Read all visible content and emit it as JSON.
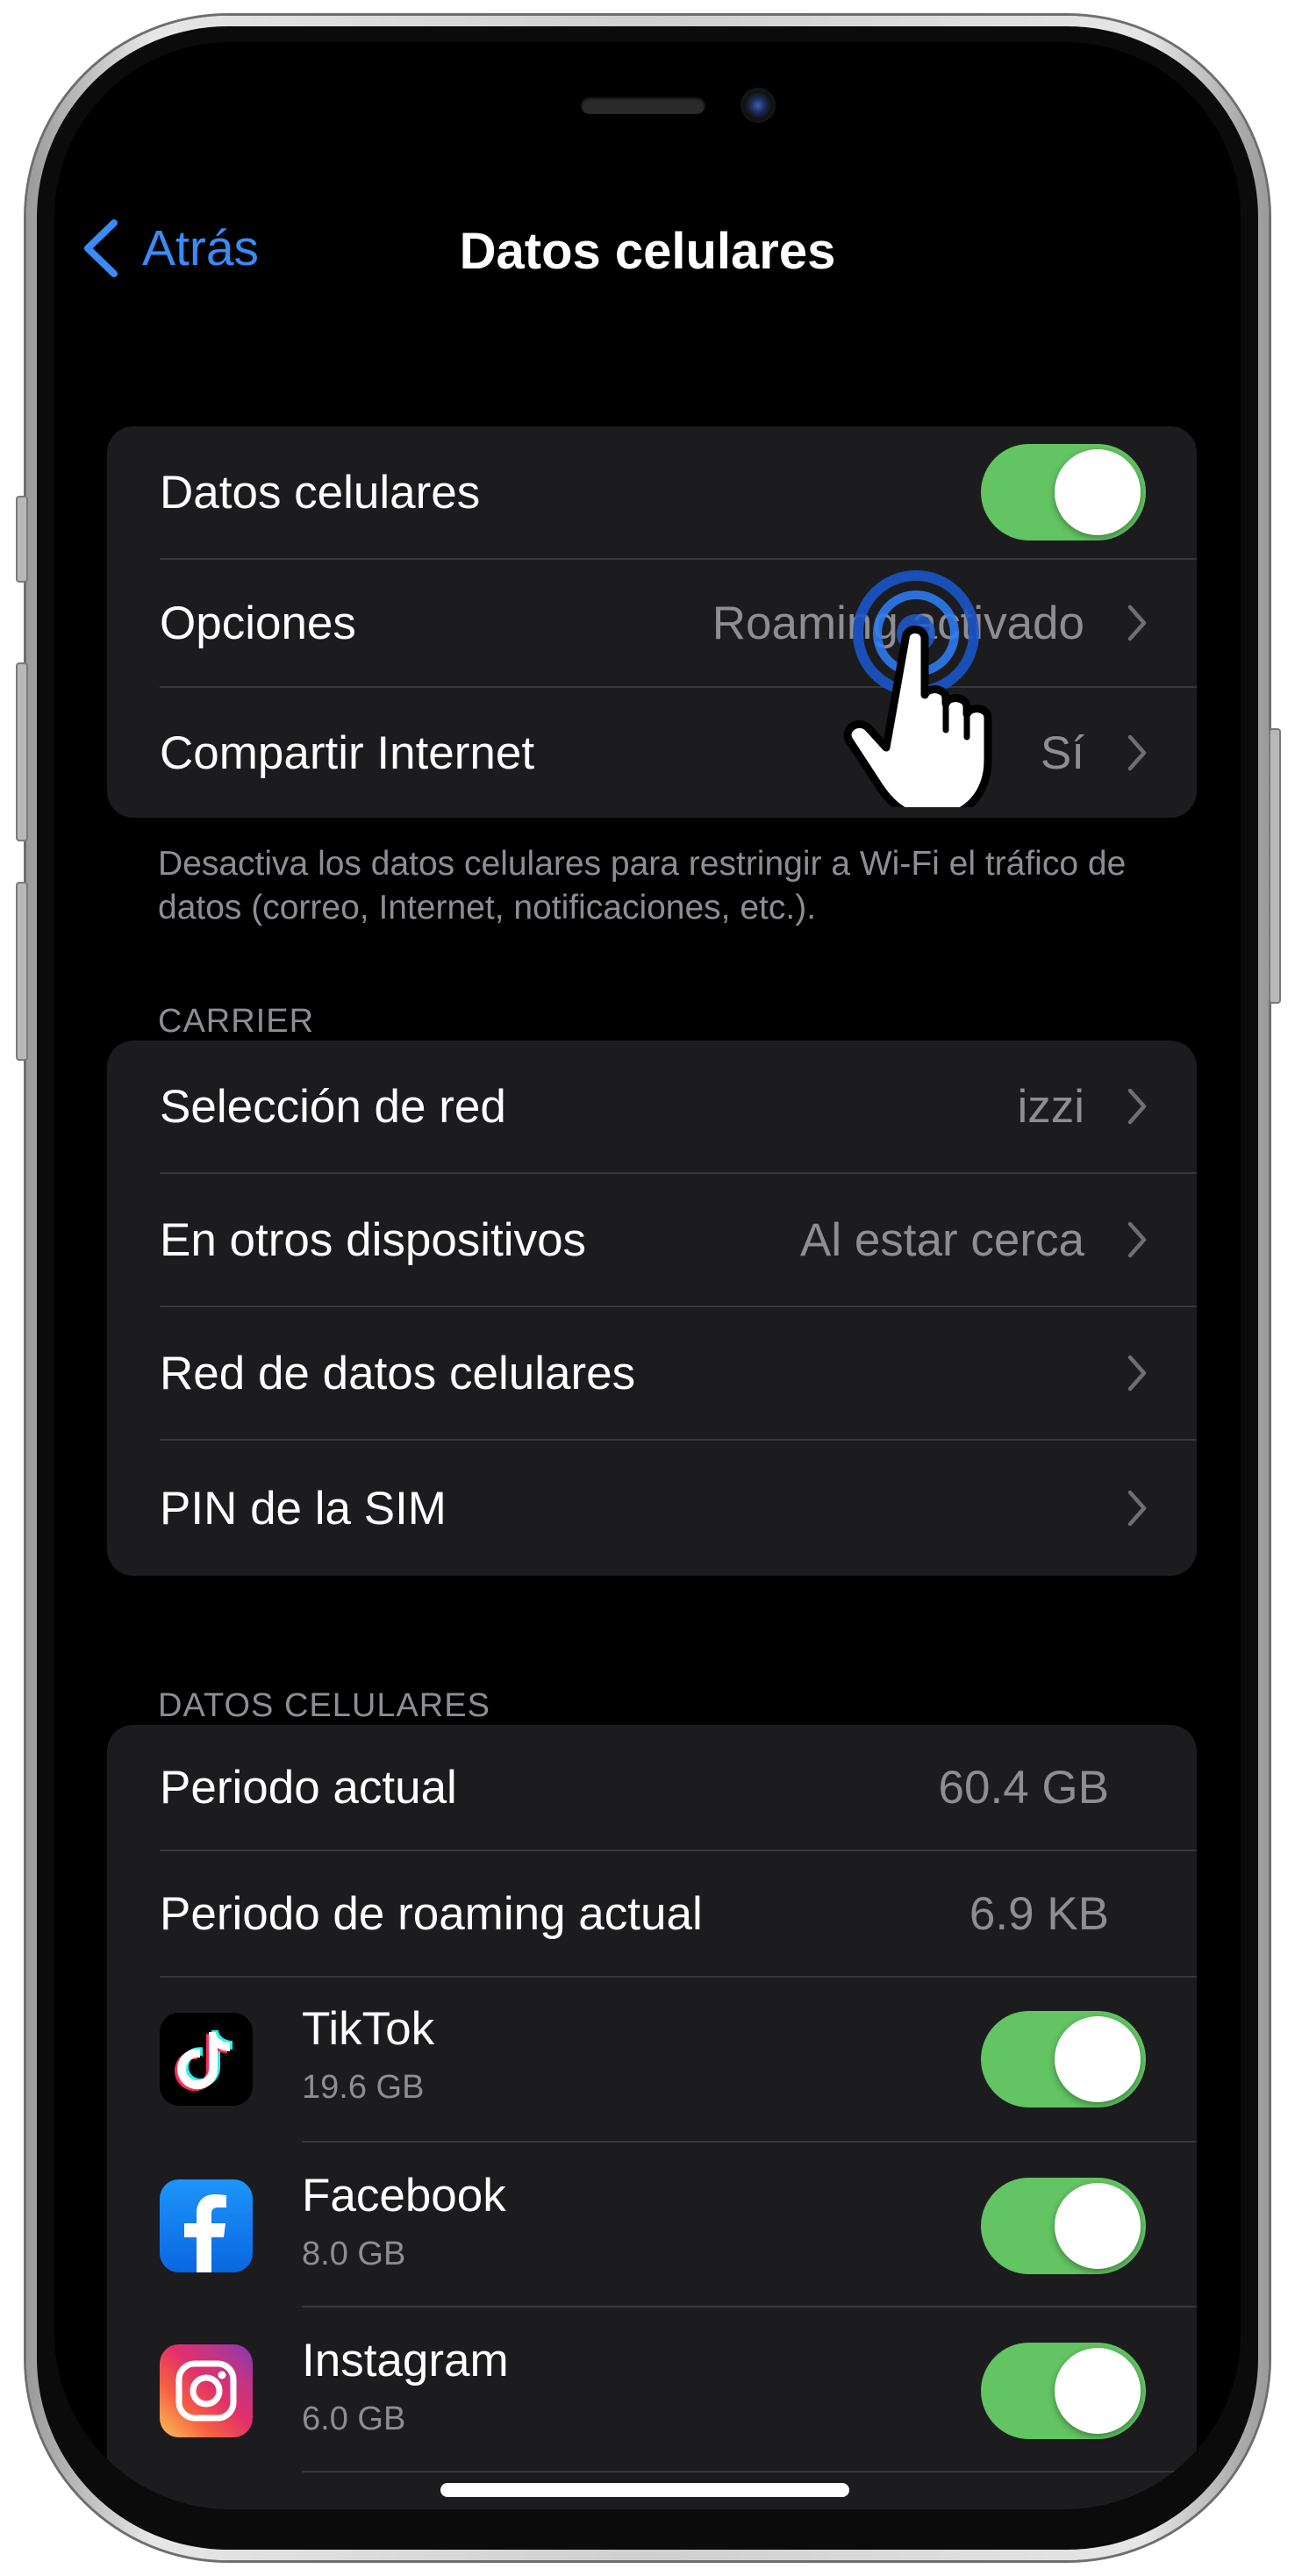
{
  "nav": {
    "back_label": "Atrás",
    "title": "Datos celulares"
  },
  "main_group": {
    "cellular_data_label": "Datos celulares",
    "cellular_data_on": true,
    "options_label": "Opciones",
    "options_value": "Roaming activado",
    "hotspot_label": "Compartir Internet",
    "hotspot_value": "Sí"
  },
  "main_footnote": "Desactiva los datos celulares para restringir a Wi-Fi el tráfico de datos (correo, Internet, notificaciones, etc.).",
  "carrier_section": {
    "header": "CARRIER",
    "network_selection_label": "Selección de red",
    "network_selection_value": "izzi",
    "other_devices_label": "En otros dispositivos",
    "other_devices_value": "Al estar cerca",
    "cellular_network_label": "Red de datos celulares",
    "sim_pin_label": "PIN de la SIM"
  },
  "usage_section": {
    "header": "DATOS CELULARES",
    "current_period_label": "Periodo actual",
    "current_period_value": "60.4 GB",
    "roaming_period_label": "Periodo de roaming actual",
    "roaming_period_value": "6.9 KB",
    "apps": [
      {
        "name": "TikTok",
        "usage": "19.6 GB",
        "enabled": true,
        "icon": "tiktok-icon"
      },
      {
        "name": "Facebook",
        "usage": "8.0 GB",
        "enabled": true,
        "icon": "facebook-icon"
      },
      {
        "name": "Instagram",
        "usage": "6.0 GB",
        "enabled": true,
        "icon": "instagram-icon"
      }
    ]
  },
  "colors": {
    "accent": "#3a8bf7",
    "toggle_on": "#62c462",
    "background": "#000000",
    "group_bg": "#1c1c1e"
  }
}
